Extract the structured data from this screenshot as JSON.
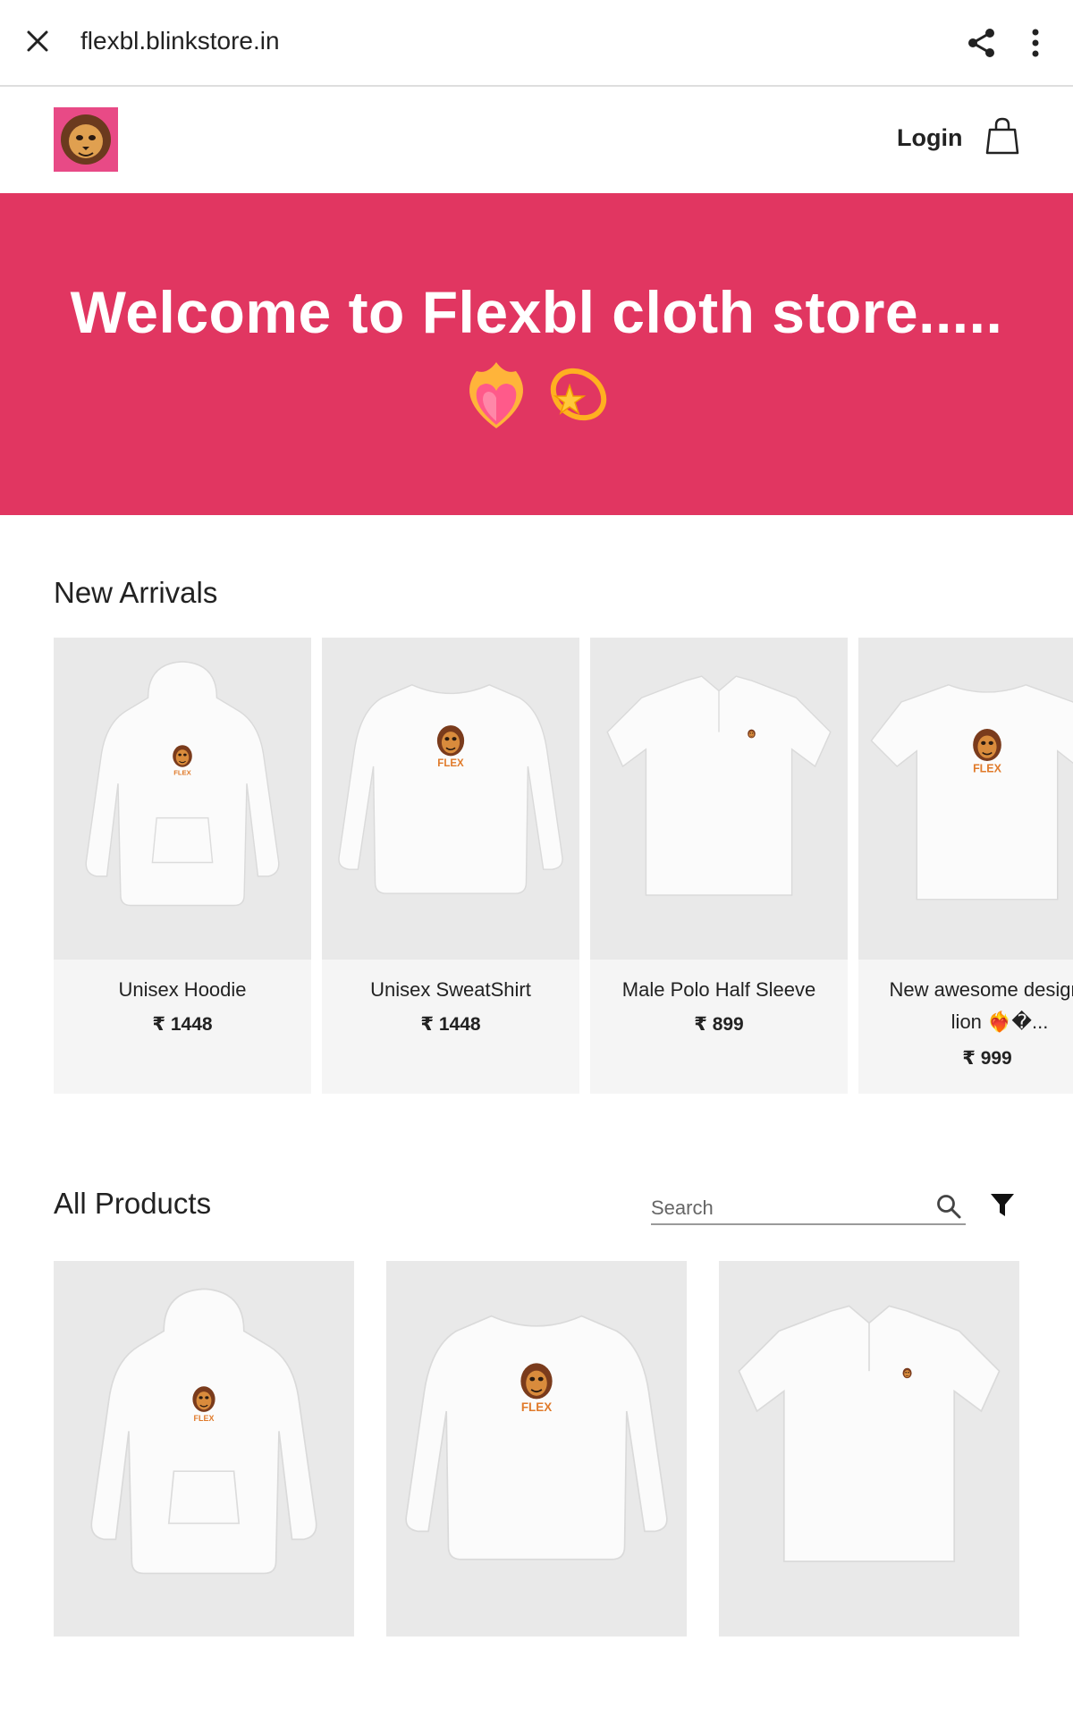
{
  "browser": {
    "url": "flexbl.blinkstore.in",
    "icons": {
      "close": "close-icon",
      "share": "share-icon",
      "menu": "more-vert-icon"
    }
  },
  "header": {
    "logo": "lion-logo",
    "login_label": "Login",
    "cart_icon": "shopping-bag-icon"
  },
  "banner": {
    "title": "Welcome to Flexbl cloth store.....",
    "emoji": [
      "❤️‍🔥",
      "💫"
    ],
    "background": "#e13661"
  },
  "new_arrivals": {
    "title": "New Arrivals",
    "products": [
      {
        "name": "Unisex Hoodie",
        "price": "₹ 1448",
        "type": "hoodie"
      },
      {
        "name": "Unisex SweatShirt",
        "price": "₹ 1448",
        "type": "sweatshirt"
      },
      {
        "name": "Male Polo Half Sleeve",
        "price": "₹ 899",
        "type": "polo"
      },
      {
        "name": "New awesome design for lion ❤️‍🔥�...",
        "price": "₹ 999",
        "type": "tshirt"
      }
    ]
  },
  "all_products": {
    "title": "All Products",
    "search_placeholder": "Search",
    "filter_icon": "filter-icon",
    "products": [
      {
        "type": "hoodie"
      },
      {
        "type": "sweatshirt"
      },
      {
        "type": "polo"
      }
    ]
  },
  "print_text": "FLEX",
  "colors": {
    "accent": "#e13661",
    "logo_bg": "#e84a86",
    "card_bg": "#f5f5f5",
    "image_bg": "#e9e9e9"
  }
}
